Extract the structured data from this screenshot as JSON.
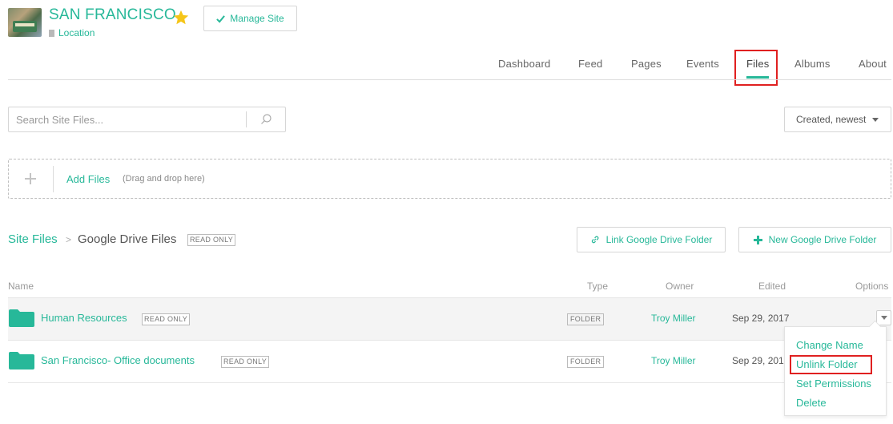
{
  "site": {
    "title": "SAN FRANCISCO",
    "location": "Location",
    "manage_label": "Manage Site"
  },
  "nav": {
    "items": [
      "Dashboard",
      "Feed",
      "Pages",
      "Events",
      "Files",
      "Albums",
      "About"
    ],
    "active": "Files"
  },
  "search": {
    "placeholder": "Search Site Files..."
  },
  "sort": {
    "selected": "Created, newest"
  },
  "dropzone": {
    "label": "Add Files",
    "hint": "(Drag and drop here)"
  },
  "breadcrumb": {
    "root": "Site Files",
    "separator": ">",
    "current": "Google Drive Files",
    "badge": "READ ONLY"
  },
  "actions": {
    "link_label": "Link Google Drive Folder",
    "new_label": "New Google Drive Folder"
  },
  "table": {
    "headers": {
      "name": "Name",
      "type": "Type",
      "owner": "Owner",
      "edited": "Edited",
      "options": "Options"
    },
    "rows": [
      {
        "name": "Human Resources",
        "badge": "READ ONLY",
        "type": "FOLDER",
        "owner": "Troy Miller",
        "edited": "Sep 29, 2017"
      },
      {
        "name": "San Francisco- Office documents",
        "badge": "READ ONLY",
        "type": "FOLDER",
        "owner": "Troy Miller",
        "edited": "Sep 29, 201"
      }
    ]
  },
  "menu": {
    "items": [
      "Change Name",
      "Unlink Folder",
      "Set Permissions",
      "Delete"
    ]
  },
  "colors": {
    "accent": "#27b899",
    "highlight": "#e02020",
    "star": "#f5c518"
  }
}
